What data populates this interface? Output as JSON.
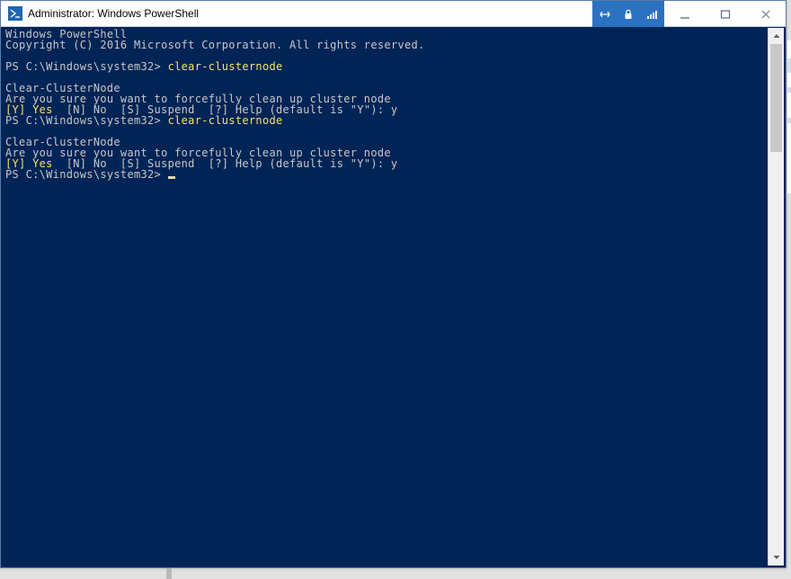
{
  "title": "Administrator: Windows PowerShell",
  "icon": "powershell-icon",
  "tray": {
    "pin": "↔",
    "lock": "🔒",
    "signal": "📶"
  },
  "shell": {
    "banner1": "Windows PowerShell",
    "banner2": "Copyright (C) 2016 Microsoft Corporation. All rights reserved.",
    "prompt": "PS C:\\Windows\\system32>",
    "cmd": "clear-clusternode",
    "confirm_title": "Clear-ClusterNode",
    "confirm_msg": "Are you sure you want to forcefully clean up cluster node",
    "opts_yes": "[Y] Yes",
    "opts_rest": "  [N] No  [S] Suspend  [?] Help (default is \"Y\"): y"
  }
}
